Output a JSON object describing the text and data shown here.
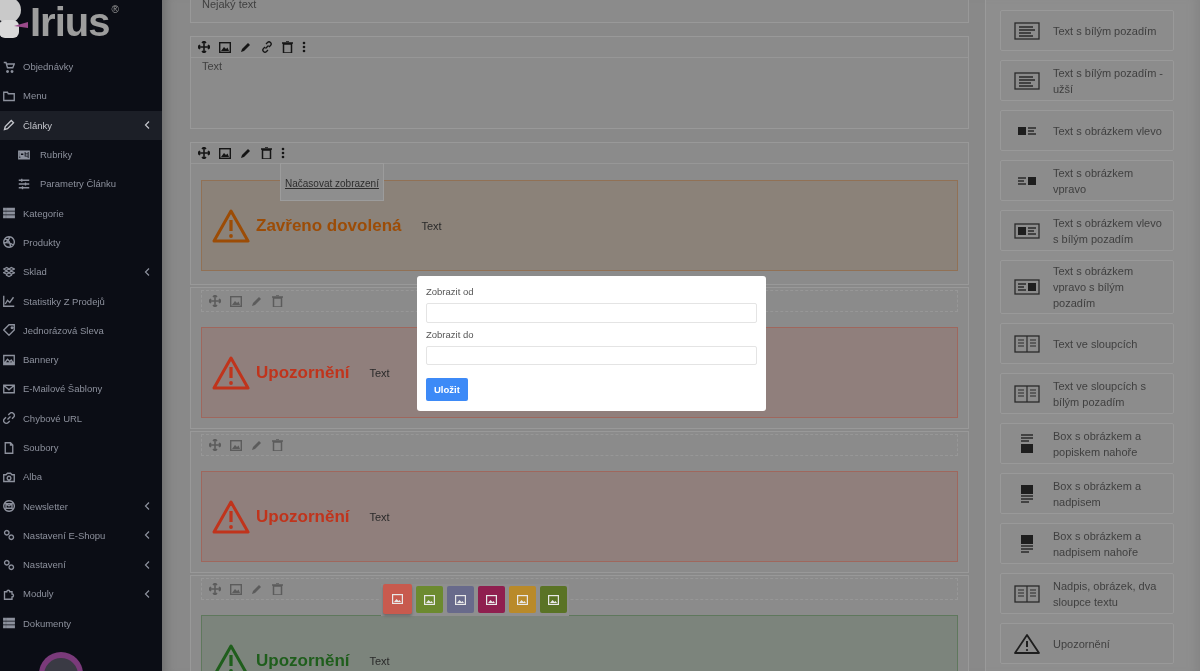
{
  "logo": {
    "name": "Irius",
    "mark": "®"
  },
  "sidebar": {
    "items": [
      {
        "label": "Objednávky",
        "selected": false,
        "submenu": false
      },
      {
        "label": "Menu",
        "selected": false,
        "submenu": false
      },
      {
        "label": "Články",
        "selected": true,
        "submenu": true,
        "children": [
          {
            "label": "Rubriky",
            "selected": false
          },
          {
            "label": "Parametry Článku",
            "selected": false
          }
        ]
      },
      {
        "label": "Kategorie",
        "selected": false,
        "submenu": false
      },
      {
        "label": "Produkty",
        "selected": false,
        "submenu": false
      },
      {
        "label": "Sklad",
        "selected": false,
        "submenu": true
      },
      {
        "label": "Statistiky Z Prodejů",
        "selected": false,
        "submenu": false
      },
      {
        "label": "Jednorázová Sleva",
        "selected": false,
        "submenu": false
      },
      {
        "label": "Bannery",
        "selected": false,
        "submenu": false
      },
      {
        "label": "E-Mailové Šablony",
        "selected": false,
        "submenu": false
      },
      {
        "label": "Chybové URL",
        "selected": false,
        "submenu": false
      },
      {
        "label": "Soubory",
        "selected": false,
        "submenu": false
      },
      {
        "label": "Alba",
        "selected": false,
        "submenu": false
      },
      {
        "label": "Newsletter",
        "selected": false,
        "submenu": true
      },
      {
        "label": "Nastavení E-Shopu",
        "selected": false,
        "submenu": true
      },
      {
        "label": "Nastavení",
        "selected": false,
        "submenu": true
      },
      {
        "label": "Moduly",
        "selected": false,
        "submenu": true
      },
      {
        "label": "Dokumenty",
        "selected": false,
        "submenu": false
      }
    ]
  },
  "blocks": [
    {
      "kind": "text",
      "text": "Nejaký text"
    },
    {
      "kind": "text",
      "text": "Text",
      "tools": [
        {
          "kind": "move"
        },
        {
          "kind": "image"
        },
        {
          "kind": "edit"
        },
        {
          "kind": "link"
        },
        {
          "kind": "delete"
        },
        {
          "kind": "more"
        }
      ]
    },
    {
      "kind": "alert",
      "color": "#9c4c06",
      "title": "Zavřeno dovolená",
      "text": "Text",
      "tools": [
        {
          "kind": "move"
        },
        {
          "kind": "image"
        },
        {
          "kind": "edit"
        },
        {
          "kind": "delete"
        },
        {
          "kind": "more"
        }
      ],
      "menu": [
        "Načasovat zobrazení"
      ]
    },
    {
      "kind": "alert",
      "color": "#c0341c",
      "title": "Upozornění",
      "text": "Text",
      "tools": [
        {
          "kind": "move"
        },
        {
          "kind": "image"
        },
        {
          "kind": "edit"
        },
        {
          "kind": "delete"
        }
      ]
    },
    {
      "kind": "alert",
      "color": "#c0341c",
      "title": "Upozornění",
      "text": "Text",
      "tools": [
        {
          "kind": "move"
        },
        {
          "kind": "image"
        },
        {
          "kind": "edit"
        },
        {
          "kind": "delete"
        }
      ]
    },
    {
      "kind": "alert",
      "color": "#1f5e1c",
      "title": "Upozornění",
      "text": "Text",
      "tools": [
        {
          "kind": "move"
        },
        {
          "kind": "image"
        },
        {
          "kind": "edit"
        },
        {
          "kind": "delete"
        }
      ]
    }
  ],
  "color_picker": {
    "swatches": [
      {
        "color": "#c85a4e",
        "selected": true
      },
      {
        "color": "#6c8a2f",
        "selected": false
      },
      {
        "color": "#686a8b",
        "selected": false
      },
      {
        "color": "#8f1f4f",
        "selected": false
      },
      {
        "color": "#b98a2a",
        "selected": false
      },
      {
        "color": "#5a7325",
        "selected": false
      }
    ]
  },
  "modal": {
    "fields": [
      {
        "label": "Zobrazit od"
      },
      {
        "label": "Zobrazit do"
      }
    ],
    "button": "Uložit"
  },
  "templates": [
    "Text s bílým pozadím",
    "Text s bílým pozadím - užší",
    "Text s obrázkem vlevo",
    "Text s obrázkem vpravo",
    "Text s obrázkem vlevo s bílým pozadím",
    "Text s obrázkem vpravo s bílým pozadím",
    "Text ve sloupcích",
    "Text ve sloupcích s bílým pozadím",
    "Box s obrázkem a popiskem nahoře",
    "Box s obrázkem a nadpisem",
    "Box s obrázkem a nadpisem nahoře",
    "Nadpis, obrázek, dva sloupce textu",
    "Upozornění"
  ]
}
